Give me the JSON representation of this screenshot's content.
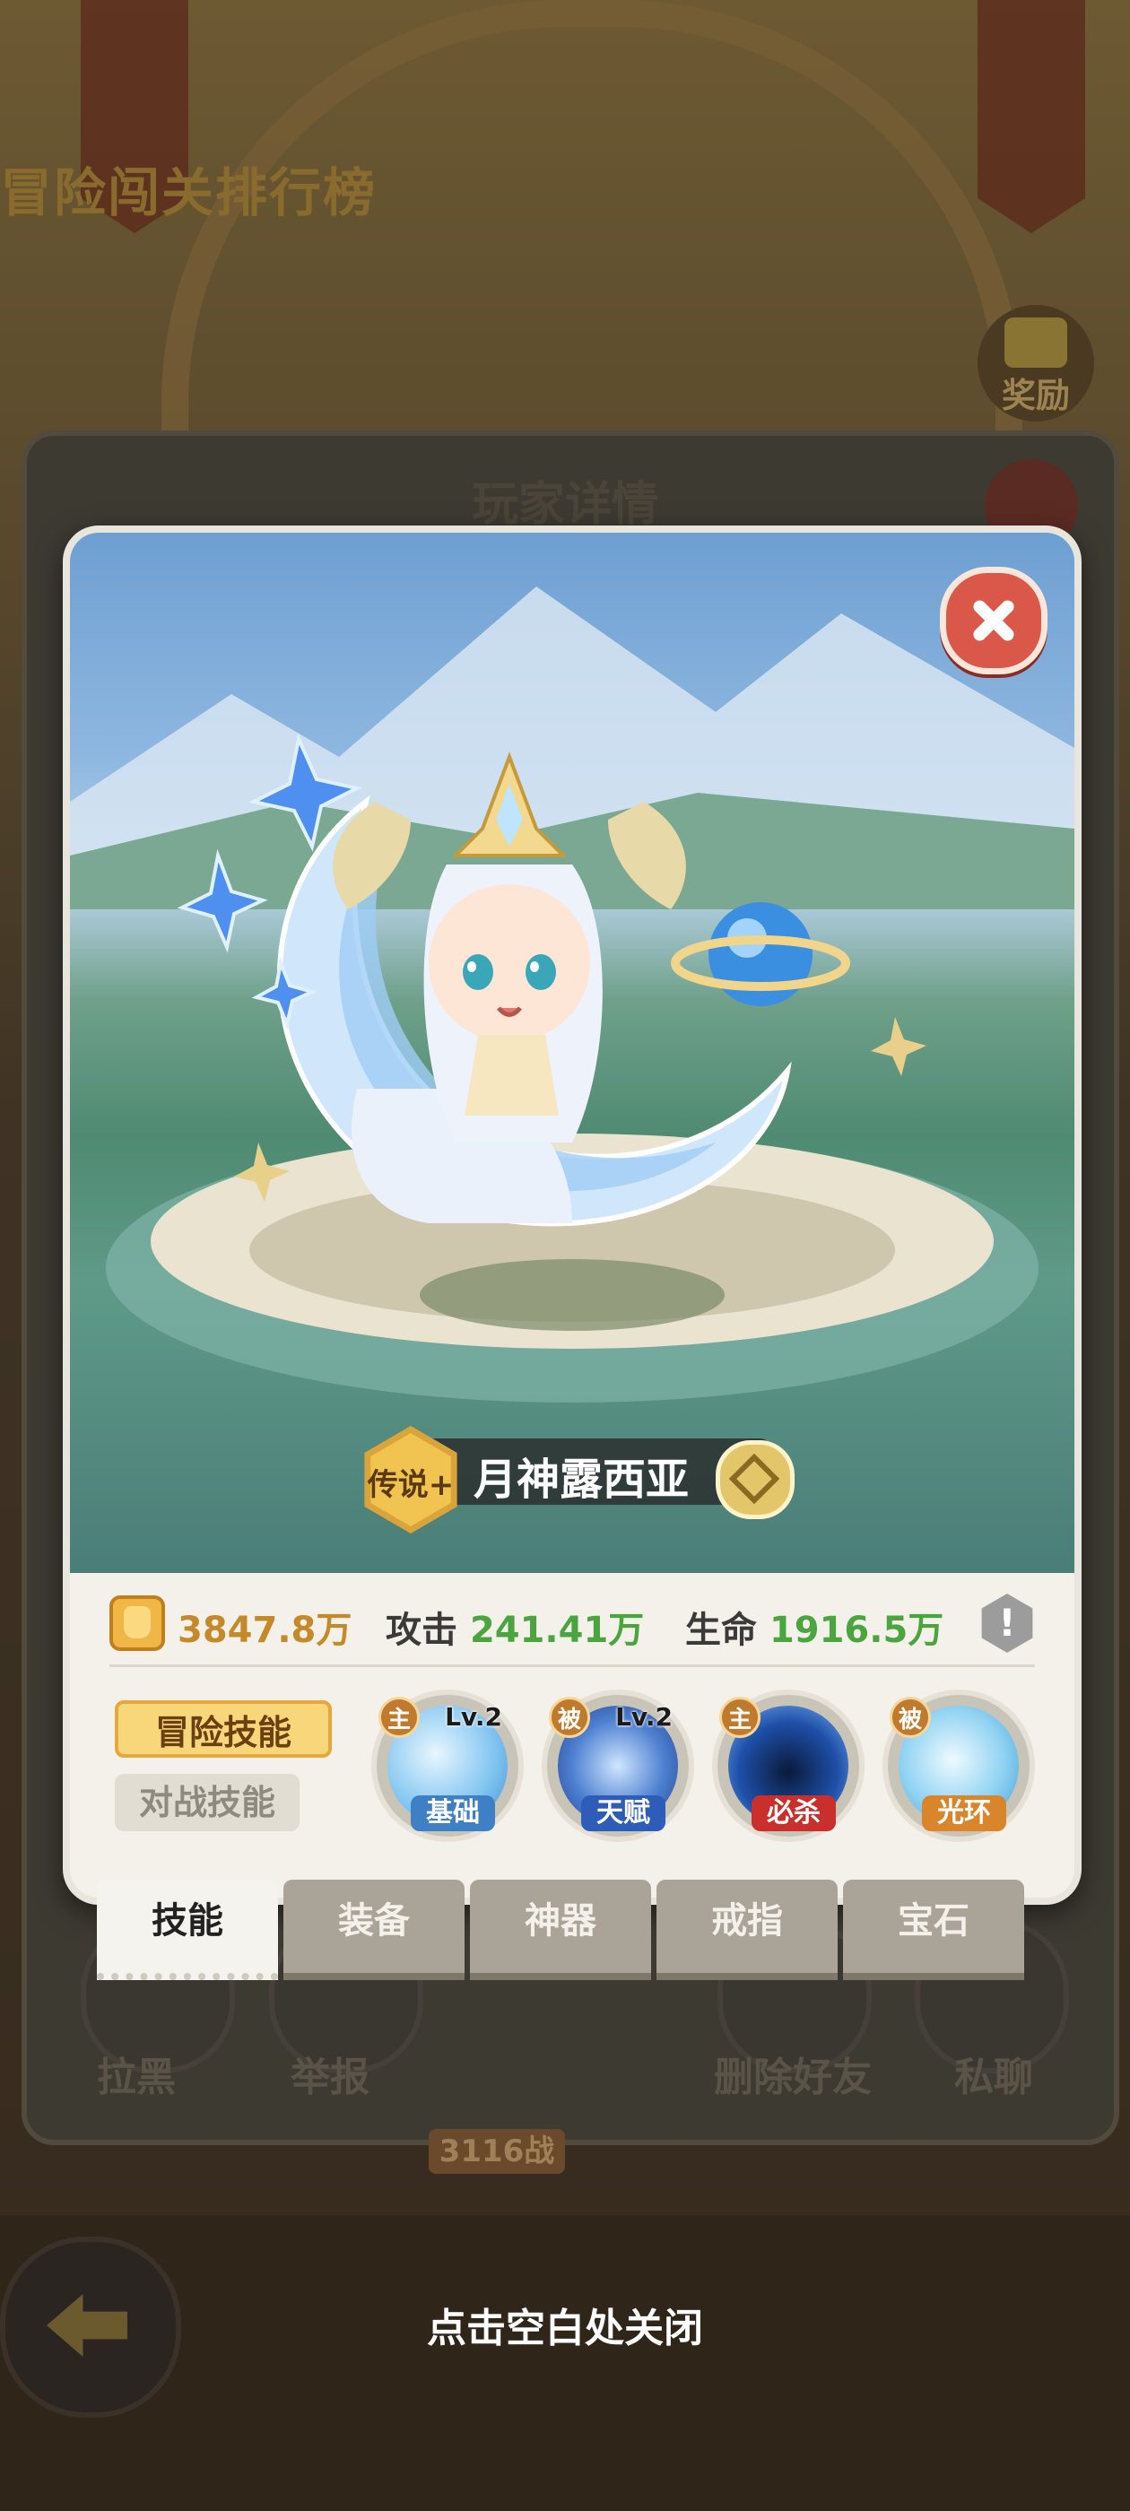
{
  "background": {
    "leaderboard_title": "冒险闯关排行榜",
    "reward_label": "奖励",
    "dialog_title": "玩家详情",
    "actions": [
      "拉黑",
      "举报",
      "删除好友",
      "私聊"
    ],
    "power_chip": "3116战",
    "close_hint": "点击空白处关闭"
  },
  "hero": {
    "rarity": "传说+",
    "name": "月神露西亚",
    "power": "3847.8万",
    "attack_label": "攻击",
    "attack_value": "241.41万",
    "hp_label": "生命",
    "hp_value": "1916.5万",
    "info_glyph": "!"
  },
  "skill_tabs": {
    "active": "冒险技能",
    "inactive": "对战技能"
  },
  "skills": [
    {
      "type": "主",
      "level": "Lv.2",
      "name": "基础"
    },
    {
      "type": "被",
      "level": "Lv.2",
      "name": "天赋"
    },
    {
      "type": "主",
      "level": "",
      "name": "必杀"
    },
    {
      "type": "被",
      "level": "",
      "name": "光环"
    }
  ],
  "tabs": [
    "技能",
    "装备",
    "神器",
    "戒指",
    "宝石"
  ],
  "colors": {
    "accent": "#f7d779",
    "stat_green": "#4aa53e",
    "close_red": "#d9584a"
  }
}
